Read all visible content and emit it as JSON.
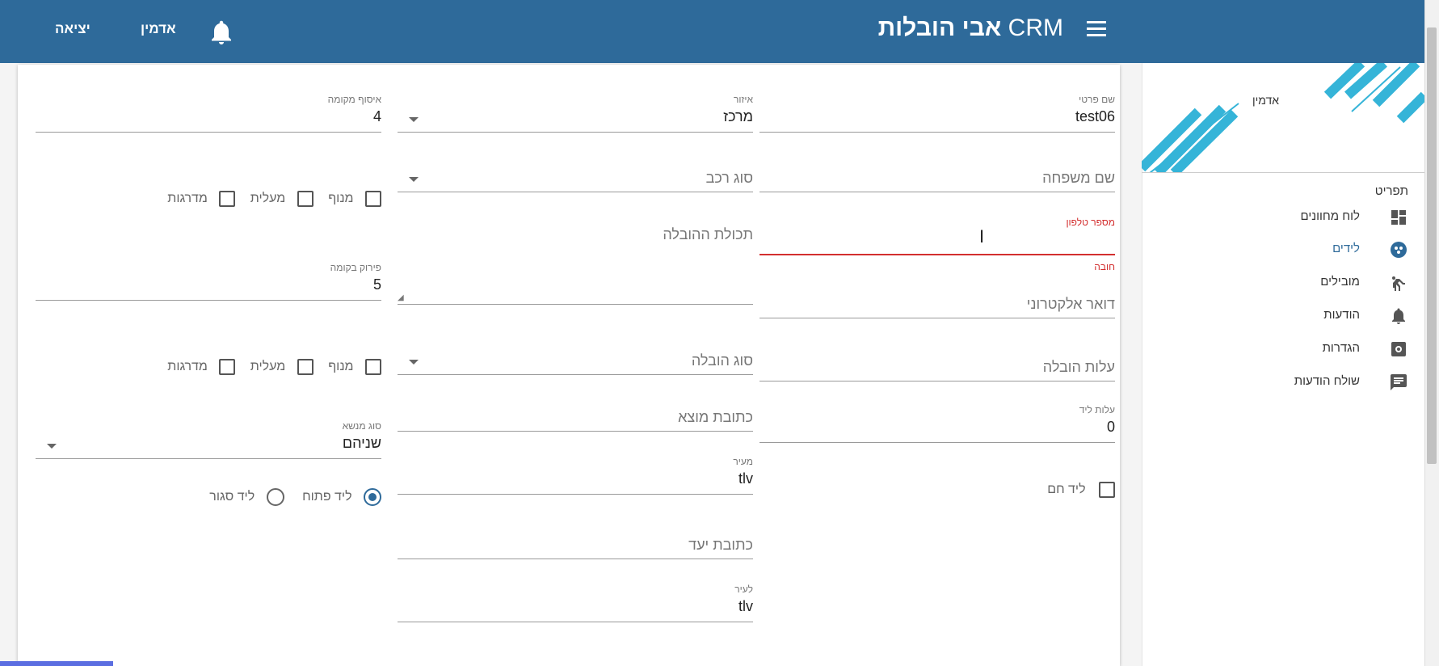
{
  "header": {
    "title_crm": "CRM",
    "title_name": "אבי הובלות",
    "admin_label": "אדמין",
    "logout_label": "יציאה",
    "menu_icon": "hamburger-icon",
    "bell_icon": "bell-icon",
    "bg_color": "#2e6a9a"
  },
  "sidebar": {
    "user_name": "אדמין",
    "section_title": "תפריט",
    "items": [
      {
        "label": "לוח מחוונים",
        "icon": "dashboard-icon",
        "active": false
      },
      {
        "label": "לידים",
        "icon": "leads-icon",
        "active": true
      },
      {
        "label": "מובילים",
        "icon": "movers-icon",
        "active": false
      },
      {
        "label": "הודעות",
        "icon": "bell-icon",
        "active": false
      },
      {
        "label": "הגדרות",
        "icon": "settings-icon",
        "active": false
      },
      {
        "label": "שולח הודעות",
        "icon": "message-icon",
        "active": false
      }
    ]
  },
  "form": {
    "col1": {
      "first_name": {
        "label": "שם פרטי",
        "value": "test06"
      },
      "last_name": {
        "placeholder": "שם משפחה"
      },
      "phone": {
        "label": "מספר טלפון",
        "value": "",
        "error": "חובה"
      },
      "email": {
        "placeholder": "דואר אלקטרוני"
      },
      "move_cost": {
        "placeholder": "עלות הובלה"
      },
      "lead_cost": {
        "label": "עלות ליד",
        "value": "0"
      },
      "hot_lead": {
        "label": "ליד חם",
        "checked": false
      }
    },
    "col2": {
      "area": {
        "label": "איזור",
        "value": "מרכז"
      },
      "vehicle_type": {
        "placeholder": "סוג רכב"
      },
      "move_content": {
        "placeholder": "תכולת ההובלה"
      },
      "move_type": {
        "placeholder": "סוג הובלה"
      },
      "origin_address": {
        "placeholder": "כתובת מוצא"
      },
      "from_city": {
        "label": "מעיר",
        "value": "tlv"
      },
      "dest_address": {
        "placeholder": "כתובת יעד"
      },
      "to_city": {
        "label": "לעיר",
        "value": "tlv"
      }
    },
    "col3": {
      "pickup_floor": {
        "label": "איסוף מקומה",
        "value": "4"
      },
      "pickup_options": [
        {
          "label": "מנוף",
          "checked": false
        },
        {
          "label": "מעלית",
          "checked": false
        },
        {
          "label": "מדרגות",
          "checked": false
        }
      ],
      "unload_floor": {
        "label": "פירוק בקומה",
        "value": "5"
      },
      "unload_options": [
        {
          "label": "מנוף",
          "checked": false
        },
        {
          "label": "מעלית",
          "checked": false
        },
        {
          "label": "מדרגות",
          "checked": false
        }
      ],
      "subject_type": {
        "label": "סוג מנשא",
        "value": "שניהם"
      },
      "lead_status": [
        {
          "label": "ליד פתוח",
          "selected": true
        },
        {
          "label": "ליד סגור",
          "selected": false
        }
      ]
    }
  }
}
